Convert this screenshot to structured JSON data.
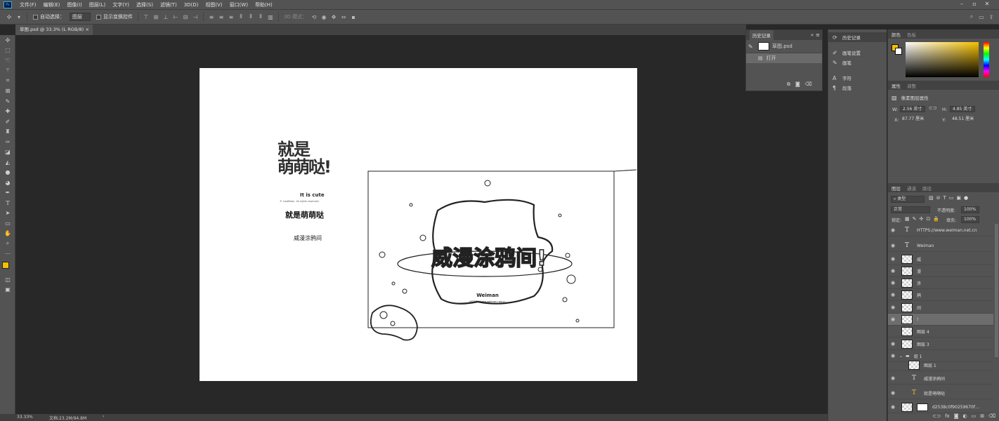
{
  "app": {
    "logo": "Ps"
  },
  "menu": [
    "文件(F)",
    "编辑(E)",
    "图像(I)",
    "图层(L)",
    "文字(Y)",
    "选择(S)",
    "滤镜(T)",
    "3D(D)",
    "视图(V)",
    "窗口(W)",
    "帮助(H)"
  ],
  "window_controls": [
    "–",
    "▫",
    "✕"
  ],
  "options": {
    "auto_select_label": "自动选择：",
    "auto_select_value": "图层",
    "show_transform_label": "显示变换控件",
    "mode_3d_label": "3D 模式："
  },
  "document": {
    "tab_title": "草图.psd @ 33.3% (L RGB/8)"
  },
  "artwork": {
    "logo_line1": "就是",
    "logo_line2": "萌萌哒!",
    "logo_en": "It is cute",
    "logo_copyright": "© CoolBean. All rights reserved.",
    "title": "就是萌萌哒",
    "subtitle": "威漫涂鸦间",
    "sketch_main": "威漫涂鸦间!",
    "sketch_brand": "Weiman",
    "sketch_url": "HTTPS://www.weiman.net.cn"
  },
  "status": {
    "zoom": "33.33%",
    "doc_info": "文档:23.2M/94.8M",
    "arrow": "›"
  },
  "history_panel": {
    "tab": "历史记录",
    "snapshot": "草图.psd",
    "state": "打开"
  },
  "dock": {
    "items": [
      {
        "label": "历史记录",
        "icon": "history-icon"
      },
      {
        "label": "画笔设置",
        "icon": "brush-settings-icon"
      },
      {
        "label": "画笔",
        "icon": "brush-icon"
      },
      {
        "label": "字符",
        "icon": "character-icon"
      },
      {
        "label": "段落",
        "icon": "paragraph-icon"
      }
    ]
  },
  "color_panel": {
    "tabs": [
      "颜色",
      "色板"
    ],
    "fg_color": "#f5c000"
  },
  "properties_panel": {
    "tabs": [
      "属性",
      "调整"
    ],
    "header": "像素图层属性",
    "w_label": "W:",
    "w_value": "2.56 英寸",
    "h_label": "H:",
    "h_value": "4.85 英寸",
    "x_label": "X:",
    "x_value": "87.77 厘米",
    "y_label": "Y:",
    "y_value": "48.51 厘米"
  },
  "layers_panel": {
    "tabs": [
      "图层",
      "通道",
      "路径"
    ],
    "filter_label": "类型",
    "blend_mode": "正常",
    "opacity_label": "不透明度:",
    "opacity_value": "100%",
    "lock_label": "锁定:",
    "fill_label": "填充:",
    "fill_value": "100%",
    "layers": [
      {
        "name": "HTTPS://www.weiman.net.cn",
        "kind": "text",
        "visible": true
      },
      {
        "name": "Weiman",
        "kind": "text",
        "visible": true
      },
      {
        "name": "威",
        "kind": "pixel",
        "visible": true
      },
      {
        "name": "漫",
        "kind": "pixel",
        "visible": true
      },
      {
        "name": "涂",
        "kind": "pixel",
        "visible": true
      },
      {
        "name": "鸦",
        "kind": "pixel",
        "visible": true
      },
      {
        "name": "间",
        "kind": "pixel",
        "visible": true
      },
      {
        "name": "!",
        "kind": "pixel",
        "visible": true,
        "selected": true
      },
      {
        "name": "图层 4",
        "kind": "pixel",
        "visible": false
      },
      {
        "name": "图层 3",
        "kind": "pixel",
        "visible": true
      },
      {
        "name": "组 1",
        "kind": "group",
        "visible": true
      },
      {
        "name": "图层 1",
        "kind": "pixel",
        "visible": false
      },
      {
        "name": "威漫涂鸦间",
        "kind": "text",
        "visible": true
      },
      {
        "name": "就是萌萌哒",
        "kind": "text-warn",
        "visible": true
      },
      {
        "name": "d2538c0f90259670f…",
        "kind": "smart",
        "visible": true
      }
    ]
  }
}
